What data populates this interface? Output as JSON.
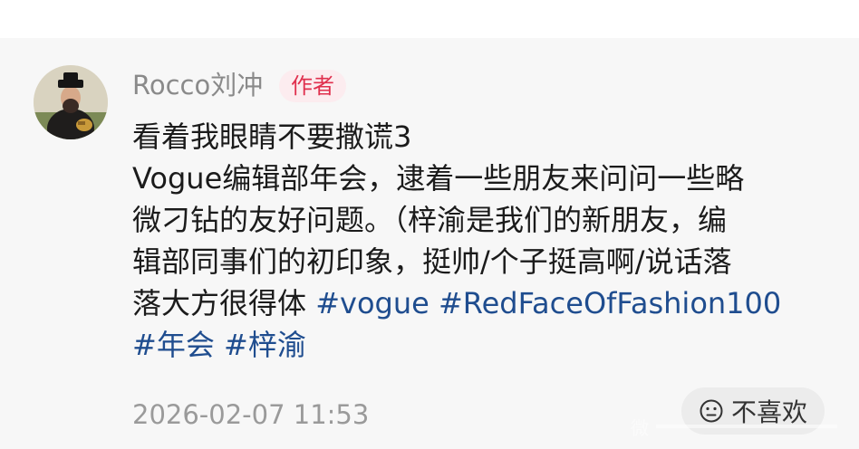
{
  "post": {
    "username": "Rocco刘冲",
    "badge": "作者",
    "content_lines": [
      "看着我眼睛不要撒谎3",
      "Vogue编辑部年会，逮着一些朋友来问问一些略",
      "微刁钻的友好问题。（梓渝是我们的新朋友，编",
      "辑部同事们的初印象，挺帅/个子挺高啊/说话落",
      "落大方很得体"
    ],
    "hashtags": [
      "#vogue",
      "#RedFaceOfFashion100",
      "#年会",
      "#梓渝"
    ],
    "timestamp": "2026-02-07 11:53",
    "dislike_label": "不喜欢",
    "dislike_icon": "neutral-face-icon"
  },
  "colors": {
    "background": "#f7f7f7",
    "badge_text": "#e0304e",
    "badge_bg": "#fcecef",
    "hashtag": "#1f4d8f",
    "text": "#1b1b1b",
    "meta": "#9a9a9a"
  }
}
